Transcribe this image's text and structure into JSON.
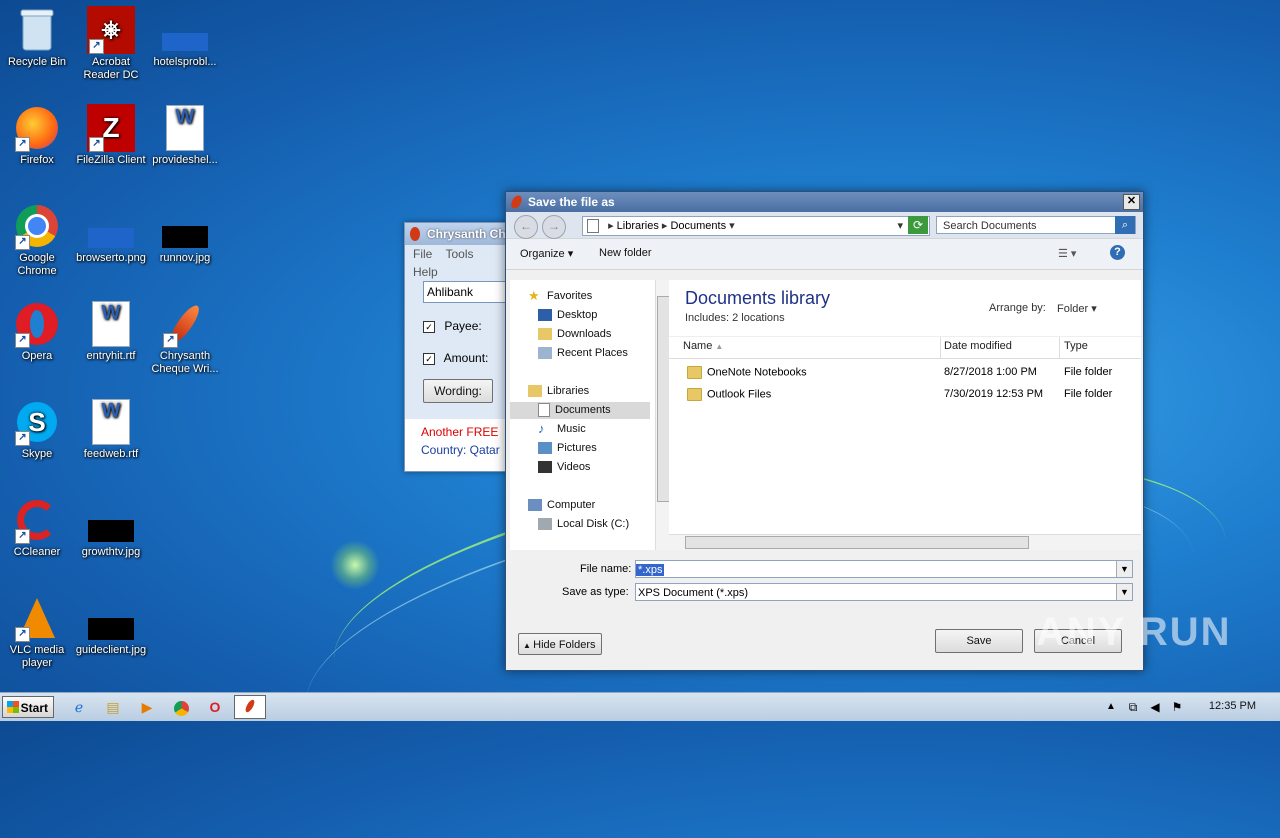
{
  "desktop": {
    "icons": [
      {
        "label": "Recycle Bin",
        "icon": "recycle-bin-icon"
      },
      {
        "label": "Acrobat Reader DC",
        "icon": "acrobat-icon"
      },
      {
        "label": "hotelsprobl...",
        "icon": "blue-image-icon"
      },
      {
        "label": "Firefox",
        "icon": "firefox-icon"
      },
      {
        "label": "FileZilla Client",
        "icon": "filezilla-icon"
      },
      {
        "label": "provideshel...",
        "icon": "word-doc-icon"
      },
      {
        "label": "Google Chrome",
        "icon": "chrome-icon"
      },
      {
        "label": "browserto.png",
        "icon": "blue-image-icon"
      },
      {
        "label": "runnov.jpg",
        "icon": "black-image-icon"
      },
      {
        "label": "Opera",
        "icon": "opera-icon"
      },
      {
        "label": "entryhit.rtf",
        "icon": "word-doc-icon"
      },
      {
        "label": "Chrysanth Cheque Wri...",
        "icon": "chrysanth-feather-icon"
      },
      {
        "label": "Skype",
        "icon": "skype-icon"
      },
      {
        "label": "feedweb.rtf",
        "icon": "word-doc-icon"
      },
      {
        "label": "CCleaner",
        "icon": "ccleaner-icon"
      },
      {
        "label": "growthtv.jpg",
        "icon": "black-image-icon"
      },
      {
        "label": "VLC media player",
        "icon": "vlc-icon"
      },
      {
        "label": "guideclient.jpg",
        "icon": "black-image-icon"
      }
    ]
  },
  "bg_window": {
    "title": "Chrysanth Ch",
    "menu": [
      "File",
      "Tools",
      "Help"
    ],
    "bank_field": "Ahlibank",
    "payee_label": "Payee:",
    "amount_label": "Amount:",
    "wording_button": "Wording:",
    "promo_red": "Another FREE",
    "promo_blue": "Country: Qatar"
  },
  "dialog": {
    "title": "Save the file as",
    "close_glyph": "✕",
    "breadcrumb": [
      "Libraries",
      "Documents"
    ],
    "search_placeholder": "Search Documents",
    "toolbar": {
      "organize": "Organize",
      "new_folder": "New folder"
    },
    "nav": {
      "favorites": "Favorites",
      "desktop": "Desktop",
      "downloads": "Downloads",
      "recent": "Recent Places",
      "libraries": "Libraries",
      "documents": "Documents",
      "music": "Music",
      "pictures": "Pictures",
      "videos": "Videos",
      "computer": "Computer",
      "local_disk": "Local Disk (C:)"
    },
    "library": {
      "title": "Documents library",
      "includes": "Includes:  2 locations",
      "arrange_label": "Arrange by:",
      "arrange_value": "Folder"
    },
    "columns": {
      "name": "Name",
      "date": "Date modified",
      "type": "Type"
    },
    "files": [
      {
        "name": "OneNote Notebooks",
        "date": "8/27/2018 1:00 PM",
        "type": "File folder"
      },
      {
        "name": "Outlook Files",
        "date": "7/30/2019 12:53 PM",
        "type": "File folder"
      }
    ],
    "filename_label": "File name:",
    "filename_value": "*.xps",
    "savetype_label": "Save as type:",
    "savetype_value": "XPS Document (*.xps)",
    "hide_folders": "Hide Folders",
    "save": "Save",
    "cancel": "Cancel"
  },
  "taskbar": {
    "start": "Start",
    "clock": "12:35 PM"
  },
  "watermark": "ANY RUN"
}
